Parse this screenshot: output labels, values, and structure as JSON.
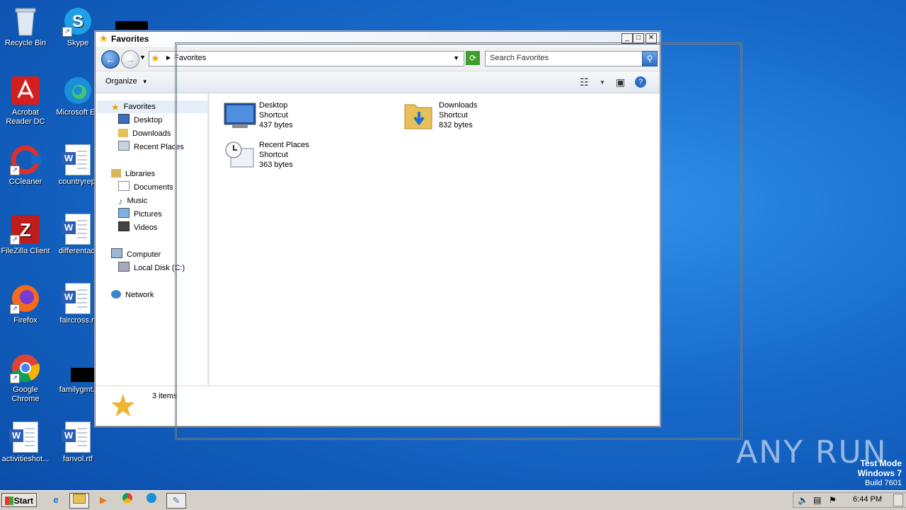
{
  "desktop": {
    "icons": [
      {
        "label": "Recycle Bin"
      },
      {
        "label": "Skype"
      },
      {
        "label": "Acrobat Reader DC"
      },
      {
        "label": "Microsoft Ed"
      },
      {
        "label": "CCleaner"
      },
      {
        "label": "countryrepl"
      },
      {
        "label": "FileZilla Client"
      },
      {
        "label": "differentact"
      },
      {
        "label": "Firefox"
      },
      {
        "label": "faircross.rt"
      },
      {
        "label": "Google Chrome"
      },
      {
        "label": "familygmt.j"
      },
      {
        "label": "activitieshot..."
      },
      {
        "label": "fanvol.rtf"
      }
    ]
  },
  "window": {
    "title": "Favorites",
    "address": "Favorites",
    "search_placeholder": "Search Favorites",
    "organize_label": "Organize"
  },
  "nav": {
    "favorites": "Favorites",
    "fav_items": [
      "Desktop",
      "Downloads",
      "Recent Places"
    ],
    "libraries": "Libraries",
    "lib_items": [
      "Documents",
      "Music",
      "Pictures",
      "Videos"
    ],
    "computer": "Computer",
    "computer_items": [
      "Local Disk (C:)"
    ],
    "network": "Network"
  },
  "files": [
    {
      "name": "Desktop",
      "type": "Shortcut",
      "size": "437 bytes"
    },
    {
      "name": "Downloads",
      "type": "Shortcut",
      "size": "832 bytes"
    },
    {
      "name": "Recent Places",
      "type": "Shortcut",
      "size": "363 bytes"
    }
  ],
  "status": {
    "count": "3 items"
  },
  "watermark": "ANY RUN",
  "testmode": {
    "line1": "Test Mode",
    "line2": "Windows 7",
    "line3": "Build 7601"
  },
  "taskbar": {
    "start": "Start",
    "clock": "6:44 PM"
  }
}
